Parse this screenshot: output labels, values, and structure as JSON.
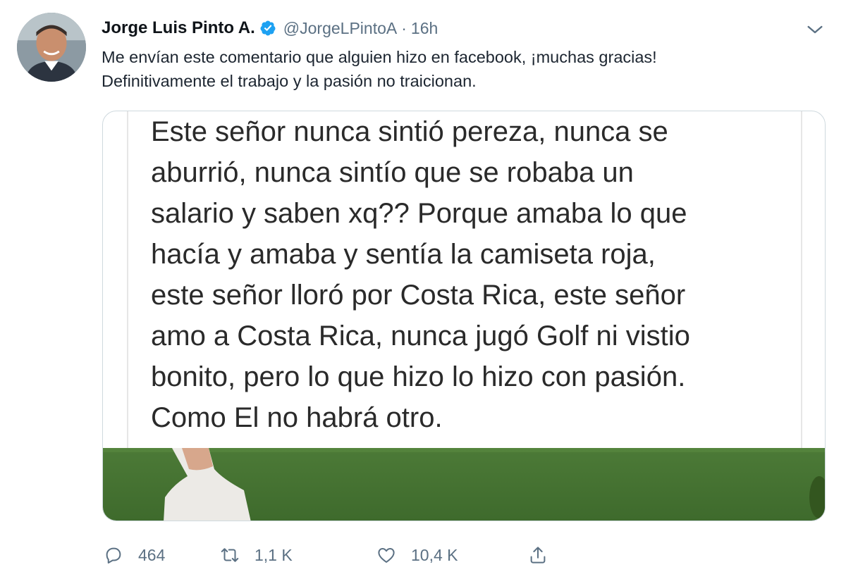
{
  "tweet": {
    "author": {
      "display_name": "Jorge Luis Pinto A.",
      "handle": "@JorgeLPintoA",
      "verified": true,
      "avatar_icon": "profile-photo"
    },
    "separator": "·",
    "time": "16h",
    "text_lines": [
      "Me envían este comentario que alguien hizo en facebook, ¡muchas gracias!",
      "Definitivamente el trabajo y la pasión no traicionan."
    ],
    "media": {
      "quote_lines": [
        "Este señor nunca sintió pereza, nunca se",
        "aburrió, nunca sintío que se robaba un",
        "salario y saben xq?? Porque amaba lo que",
        "hacía y amaba y sentía la camiseta roja,",
        "este señor lloró por Costa Rica, este señor",
        "amo a Costa Rica, nunca jugó Golf ni vistio",
        "bonito, pero lo que hizo lo hizo con pasión.",
        "Como El no habrá otro."
      ]
    },
    "actions": {
      "replies": "464",
      "retweets": "1,1 K",
      "likes": "10,4 K"
    },
    "colors": {
      "text": "#0f1419",
      "secondary": "#5b7083",
      "verified": "#1da1f2",
      "border": "#cfd9de"
    }
  }
}
